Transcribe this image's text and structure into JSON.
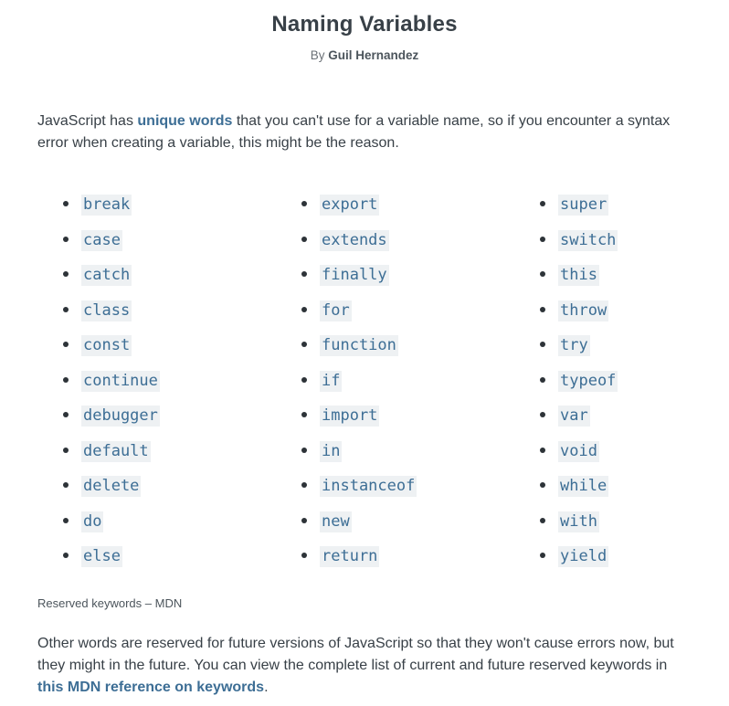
{
  "header": {
    "title": "Naming Variables",
    "by_prefix": "By",
    "author": "Guil Hernandez"
  },
  "intro": {
    "before": "JavaScript has ",
    "link": "unique words",
    "after": " that you can't use for a variable name, so if you encounter a syntax error when creating a variable, this might be the reason."
  },
  "keywords": {
    "column1": [
      "break",
      "case",
      "catch",
      "class",
      "const",
      "continue",
      "debugger",
      "default",
      "delete",
      "do",
      "else"
    ],
    "column2": [
      "export",
      "extends",
      "finally",
      "for",
      "function",
      "if",
      "import",
      "in",
      "instanceof",
      "new",
      "return"
    ],
    "column3": [
      "super",
      "switch",
      "this",
      "throw",
      "try",
      "typeof",
      "var",
      "void",
      "while",
      "with",
      "yield"
    ]
  },
  "caption": "Reserved keywords – MDN",
  "outro": {
    "before": "Other words are reserved for future versions of JavaScript so that they won't cause errors now, but they might in the future. You can view the complete list of current and future reserved keywords in ",
    "link": "this MDN reference on keywords",
    "after": "."
  },
  "colors": {
    "link": "#3d6e95",
    "code_bg": "#eef1f3",
    "text": "#384047"
  }
}
